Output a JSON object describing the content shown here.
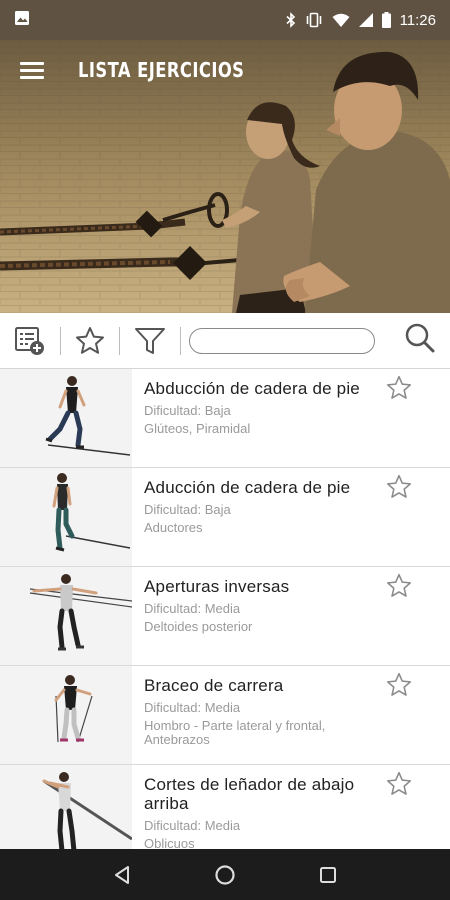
{
  "status_bar": {
    "time": "11:26",
    "icons": [
      "image-icon",
      "bluetooth-icon",
      "vibrate-icon",
      "wifi-icon",
      "signal-icon",
      "battery-icon"
    ]
  },
  "header": {
    "title": "LISTA EJERCICIOS",
    "menu_icon": "hamburger-menu-icon"
  },
  "toolbar": {
    "search_placeholder": "",
    "search_value": "",
    "icons": [
      "add-list-icon",
      "star-icon",
      "filter-icon",
      "search-icon"
    ]
  },
  "exercises": [
    {
      "name": "Abducción de cadera de pie",
      "difficulty": "Dificultad: Baja",
      "muscles": "Glúteos, Piramidal",
      "favorite": false
    },
    {
      "name": "Aducción de cadera de pie",
      "difficulty": "Dificultad: Baja",
      "muscles": "Aductores",
      "favorite": false
    },
    {
      "name": "Aperturas inversas",
      "difficulty": "Dificultad: Media",
      "muscles": "Deltoides posterior",
      "favorite": false
    },
    {
      "name": "Braceo de carrera",
      "difficulty": "Dificultad: Media",
      "muscles": "Hombro - Parte lateral y frontal, Antebrazos",
      "favorite": false
    },
    {
      "name": "Cortes de leñador de abajo arriba",
      "difficulty": "Dificultad: Media",
      "muscles": "Oblicuos",
      "favorite": false
    }
  ],
  "nav_bar": {
    "buttons": [
      "back-icon",
      "home-icon",
      "recents-icon"
    ]
  },
  "colors": {
    "status_bar": "#5f5243",
    "hero_tint": "#a48c60",
    "text_primary": "#222222",
    "text_secondary": "#9a9a9a",
    "nav_bar": "#1c1c1c"
  }
}
